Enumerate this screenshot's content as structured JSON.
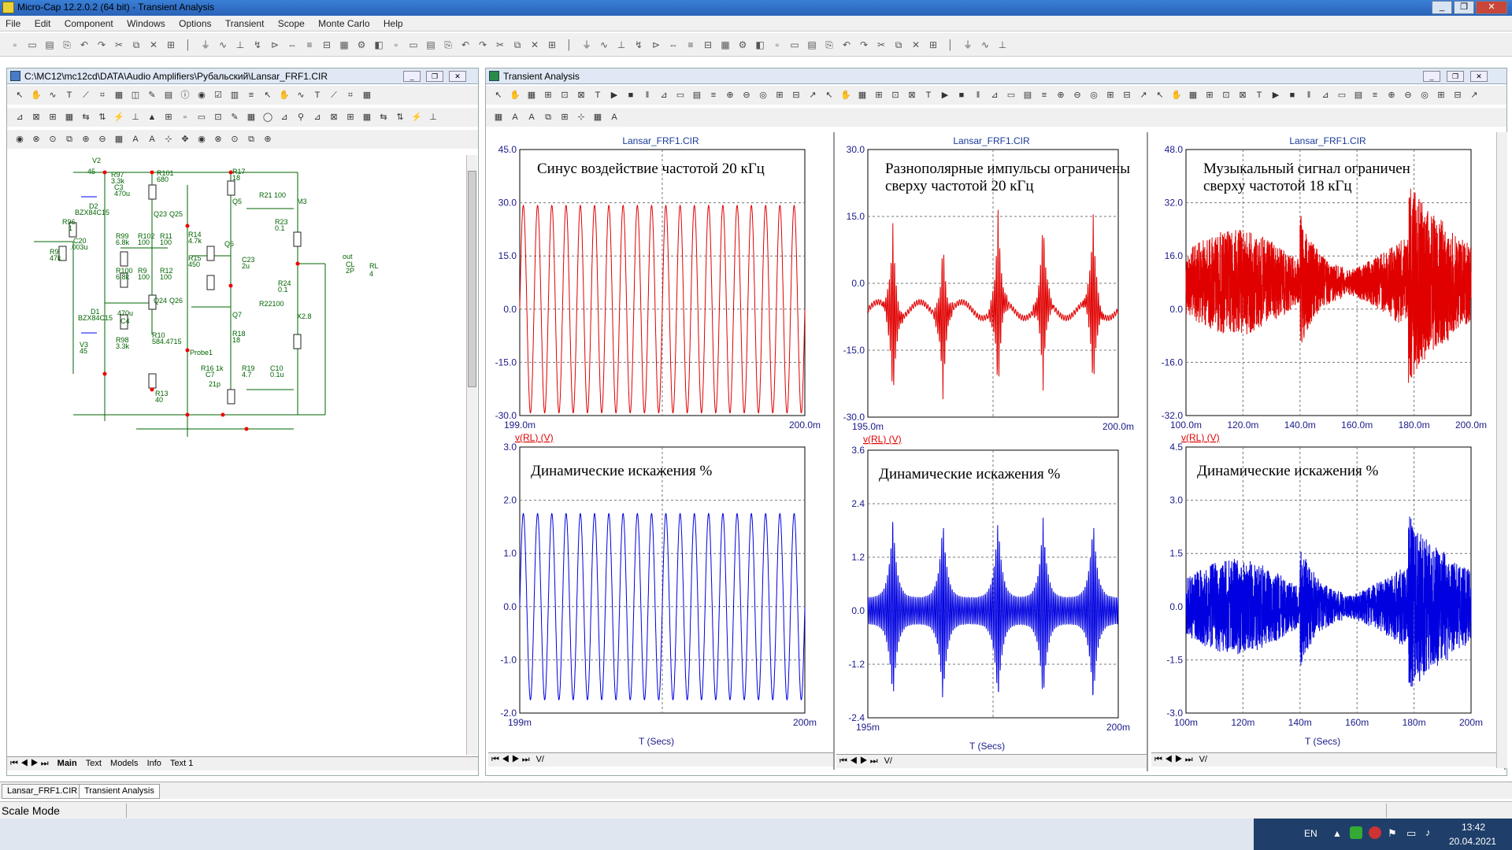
{
  "app": {
    "title": "Micro-Cap 12.2.0.2 (64 bit) - Transient Analysis"
  },
  "menu": [
    "File",
    "Edit",
    "Component",
    "Windows",
    "Options",
    "Transient",
    "Scope",
    "Monte Carlo",
    "Help"
  ],
  "schematic": {
    "title": "C:\\MC12\\mc12cd\\DATA\\Audio Amplifiers\\Рубальский\\Lansar_FRF1.CIR",
    "tabs": [
      "Main",
      "Text",
      "Models",
      "Info",
      "Text 1"
    ],
    "labels": [
      {
        "t": "V2"
      },
      {
        "t": "45"
      },
      {
        "t": "R97"
      },
      {
        "t": "3.3k"
      },
      {
        "t": "C3"
      },
      {
        "t": "470u"
      },
      {
        "t": "D2"
      },
      {
        "t": "BZX84C15"
      },
      {
        "t": "R101"
      },
      {
        "t": "680"
      },
      {
        "t": "R17"
      },
      {
        "t": "18"
      },
      {
        "t": "Q5"
      },
      {
        "t": "R21 100"
      },
      {
        "t": "M3"
      },
      {
        "t": "Q23"
      },
      {
        "t": "Q25"
      },
      {
        "t": "R96"
      },
      {
        "t": "1"
      },
      {
        "t": "R99"
      },
      {
        "t": "6.8k"
      },
      {
        "t": "R102"
      },
      {
        "t": "100"
      },
      {
        "t": "R11"
      },
      {
        "t": "100"
      },
      {
        "t": "R14"
      },
      {
        "t": "4.7k"
      },
      {
        "t": "Q6"
      },
      {
        "t": "R23"
      },
      {
        "t": "0.1"
      },
      {
        "t": "R9"
      },
      {
        "t": "47k"
      },
      {
        "t": "C20"
      },
      {
        "t": ".003u"
      },
      {
        "t": "R15"
      },
      {
        "t": "450"
      },
      {
        "t": "C23"
      },
      {
        "t": "2u"
      },
      {
        "t": "out"
      },
      {
        "t": "CL"
      },
      {
        "t": "2P"
      },
      {
        "t": "RL"
      },
      {
        "t": "4"
      },
      {
        "t": "R100"
      },
      {
        "t": "6.8k"
      },
      {
        "t": "R9"
      },
      {
        "t": "100"
      },
      {
        "t": "R12"
      },
      {
        "t": "100"
      },
      {
        "t": "R24"
      },
      {
        "t": "0.1"
      },
      {
        "t": "Q24"
      },
      {
        "t": "Q26"
      },
      {
        "t": "R22100"
      },
      {
        "t": "D1"
      },
      {
        "t": "BZX84C15"
      },
      {
        "t": "470u"
      },
      {
        "t": "C4"
      },
      {
        "t": "Q7"
      },
      {
        "t": "X2.8"
      },
      {
        "t": "V3"
      },
      {
        "t": "45"
      },
      {
        "t": "R98"
      },
      {
        "t": "3.3k"
      },
      {
        "t": "R10"
      },
      {
        "t": "584.4715"
      },
      {
        "t": "R18"
      },
      {
        "t": "18"
      },
      {
        "t": "Probe1"
      },
      {
        "t": "R16 1k"
      },
      {
        "t": "C7"
      },
      {
        "t": "21p"
      },
      {
        "t": "R19"
      },
      {
        "t": "4.7"
      },
      {
        "t": "C10"
      },
      {
        "t": "0.1u"
      },
      {
        "t": "R13"
      },
      {
        "t": "40"
      }
    ]
  },
  "transient": {
    "title": "Transient Analysis",
    "panels": [
      {
        "file": "Lansar_FRF1.CIR",
        "top": {
          "text1": "Синус воздействие частотой 20 кГц",
          "text2": "",
          "yticks": [
            "45.0",
            "30.0",
            "15.0",
            "0.0",
            "-15.0",
            "-30.0"
          ],
          "xticks": [
            "199.0m",
            "200.0m"
          ],
          "ylabel": "v(RL) (V)"
        },
        "bot": {
          "text1": "Динамические искажения %",
          "yticks": [
            "3.0",
            "2.0",
            "1.0",
            "0.0",
            "-1.0",
            "-2.0"
          ],
          "xticks": [
            "199m",
            "200m"
          ],
          "xlabel": "T (Secs)"
        }
      },
      {
        "file": "Lansar_FRF1.CIR",
        "top": {
          "text1": "Разнополярные импульсы ограничены",
          "text2": "сверху частотой 20 кГц",
          "yticks": [
            "30.0",
            "15.0",
            "0.0",
            "-15.0",
            "-30.0"
          ],
          "xticks": [
            "195.0m",
            "200.0m"
          ],
          "ylabel": "v(RL) (V)"
        },
        "bot": {
          "text1": "Динамические искажения %",
          "yticks": [
            "3.6",
            "2.4",
            "1.2",
            "0.0",
            "-1.2",
            "-2.4"
          ],
          "xticks": [
            "195m",
            "200m"
          ],
          "xlabel": "T (Secs)"
        }
      },
      {
        "file": "Lansar_FRF1.CIR",
        "top": {
          "text1": "Музыкальный сигнал ограничен",
          "text2": "сверху частотой 18 кГц",
          "yticks": [
            "48.0",
            "32.0",
            "16.0",
            "0.0",
            "-16.0",
            "-32.0"
          ],
          "xticks": [
            "100.0m",
            "120.0m",
            "140.0m",
            "160.0m",
            "180.0m",
            "200.0m"
          ],
          "ylabel": "v(RL) (V)"
        },
        "bot": {
          "text1": "Динамические искажения %",
          "yticks": [
            "4.5",
            "3.0",
            "1.5",
            "0.0",
            "-1.5",
            "-3.0"
          ],
          "xticks": [
            "100m",
            "120m",
            "140m",
            "160m",
            "180m",
            "200m"
          ],
          "xlabel": "T (Secs)"
        }
      }
    ]
  },
  "bottom_tabs": [
    "Lansar_FRF1.CIR",
    "Transient Analysis"
  ],
  "status": "Scale Mode",
  "tray": {
    "lang": "EN",
    "time": "13:42",
    "date": "20.04.2021"
  },
  "colors": {
    "trace_red": "#e00000",
    "trace_blue": "#0000e0",
    "axis": "#1a1a8a",
    "grid": "#666666"
  }
}
